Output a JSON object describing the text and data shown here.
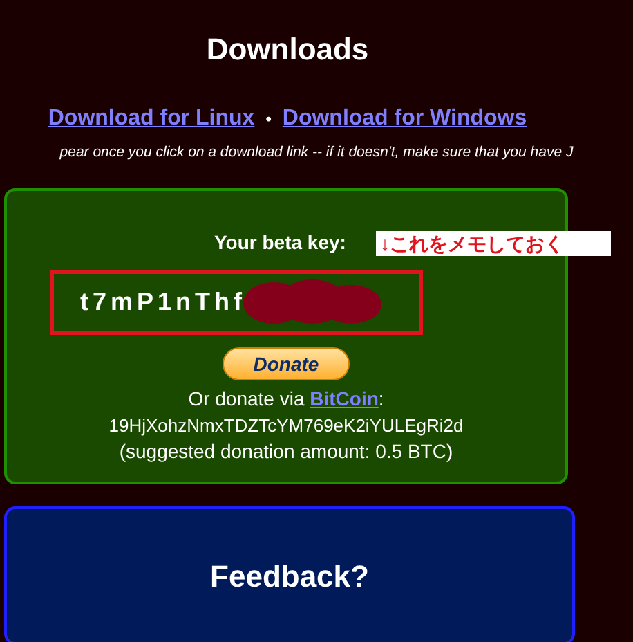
{
  "title": "Downloads",
  "links": [
    {
      "label": "Download for Linux"
    },
    {
      "label": "Download for Windows"
    }
  ],
  "separator": "•",
  "notice": "pear once you click on a download link -- if it doesn't, make sure that you have J",
  "key_panel": {
    "label": "Your beta key:",
    "annotation": "↓これをメモしておく",
    "key": "t7mP1nThf",
    "donate_button": "Donate",
    "donate_prefix": "Or donate via ",
    "donate_link": "BitCoin",
    "donate_suffix": ":",
    "address": "19HjXohzNmxTDZTcYM769eK2iYULEgRi2d",
    "suggestion": "(suggested donation amount: 0.5 BTC)"
  },
  "feedback": {
    "title": "Feedback?"
  }
}
